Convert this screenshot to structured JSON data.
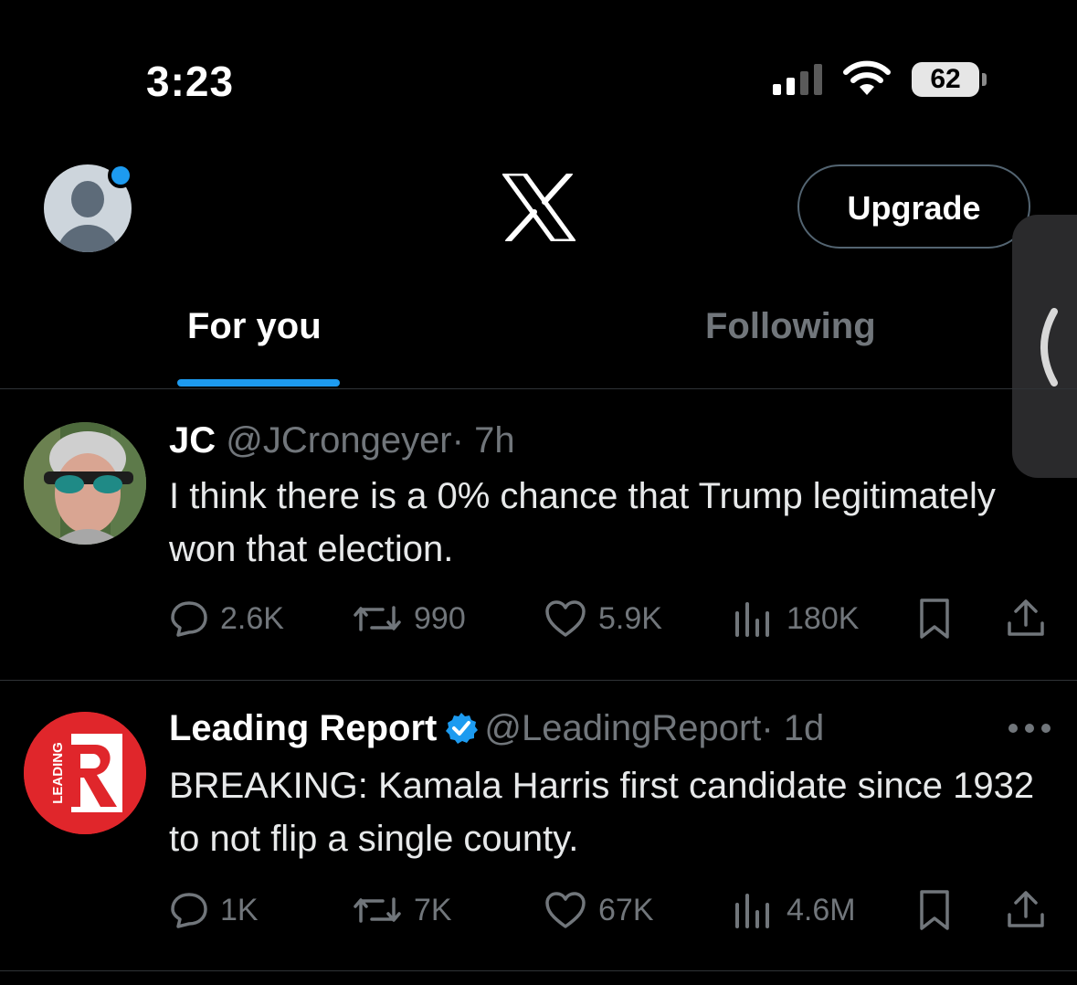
{
  "status_bar": {
    "time": "3:23",
    "battery": "62"
  },
  "header": {
    "upgrade_label": "Upgrade"
  },
  "tabs": [
    {
      "label": "For you",
      "active": true
    },
    {
      "label": "Following",
      "active": false
    }
  ],
  "tweets": [
    {
      "name": "JC",
      "handle": "@JCrongeyer",
      "time": "· 7h",
      "verified": false,
      "text": "I think there is a 0% chance that Trump legitimately won that election.",
      "replies": "2.6K",
      "retweets": "990",
      "likes": "5.9K",
      "views": "180K"
    },
    {
      "name": "Leading Report",
      "handle": "@LeadingReport",
      "time": "· 1d",
      "verified": true,
      "text": "BREAKING: Kamala Harris first candidate since 1932 to not flip a single county.",
      "replies": "1K",
      "retweets": "7K",
      "likes": "67K",
      "views": "4.6M",
      "logo_text": "LEADING",
      "logo_letter": "R"
    }
  ],
  "colors": {
    "accent": "#1d9bf0",
    "muted": "#71767b",
    "background": "#000000",
    "leading_red": "#e0262b"
  },
  "icons": [
    "signal-icon",
    "wifi-icon",
    "battery-icon",
    "x-logo-icon",
    "reply-icon",
    "retweet-icon",
    "like-icon",
    "views-icon",
    "bookmark-icon",
    "share-icon",
    "more-icon",
    "verified-icon",
    "chevron-left-icon"
  ]
}
